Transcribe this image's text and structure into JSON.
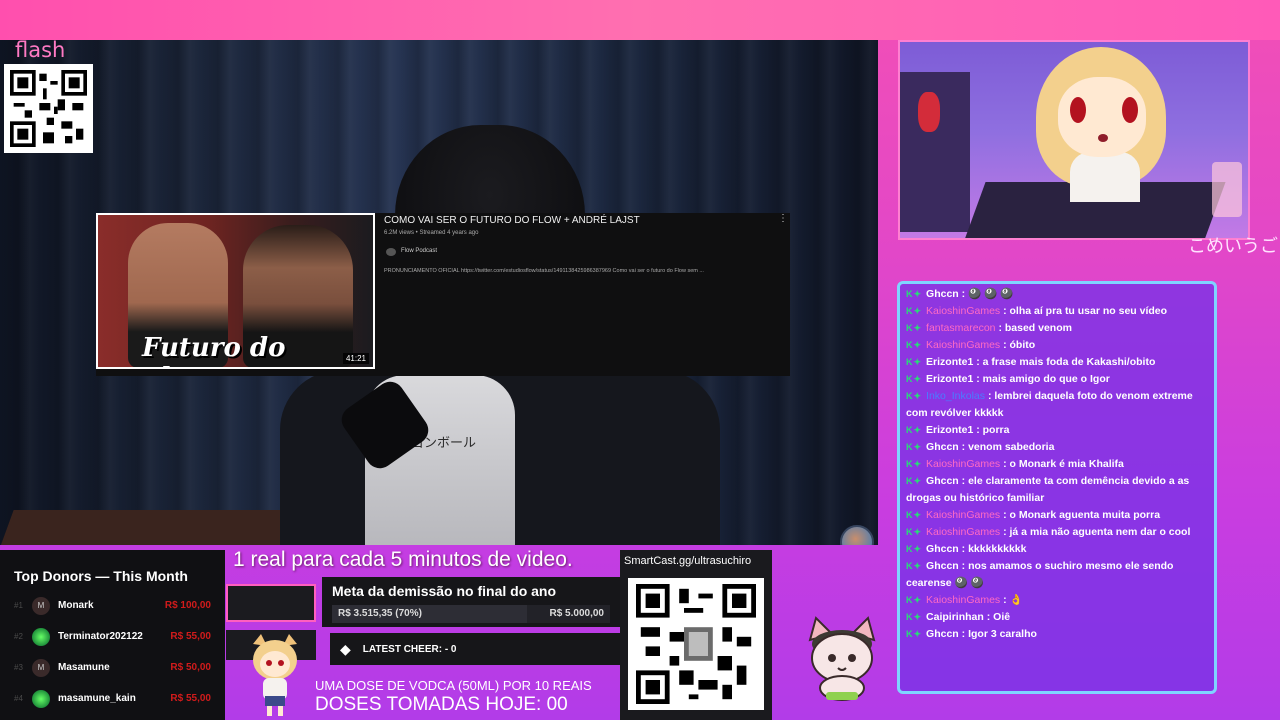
{
  "overlay": {
    "logo_text": "flash",
    "japanese_text": "こめいうご"
  },
  "youtube_card": {
    "thumb_title": "Futuro do Flow",
    "duration": "41:21",
    "title": "COMO VAI SER O FUTURO DO FLOW + ANDRÉ LAJST",
    "meta": "6.2M views • Streamed 4 years ago",
    "channel": "Flow Podcast",
    "description": "PRONUNCIAMENTO OFICIAL https://twitter.com/estudiosflow/status/1491138425986387969 Como vai ser o futuro do Flow sem ...",
    "menu_icon": "⋮"
  },
  "video": {
    "shirt_print": "ドラゴンボール"
  },
  "chat": {
    "badge_text": "K✦",
    "messages": [
      {
        "user": "Ghccn",
        "color": "white",
        "text": ": 🎱 🎱 🎱"
      },
      {
        "user": "KaioshinGames",
        "color": "pink",
        "text": ": olha aí pra tu usar no seu vídeo"
      },
      {
        "user": "fantasmarecon",
        "color": "pink",
        "text": ": based venom"
      },
      {
        "user": "KaioshinGames",
        "color": "pink",
        "text": ": óbito"
      },
      {
        "user": "Erizonte1",
        "color": "white",
        "text": ": a frase mais foda de Kakashi/obito"
      },
      {
        "user": "Erizonte1",
        "color": "white",
        "text": ": mais amigo do que o Igor"
      },
      {
        "user": "Inko_Inkolas",
        "color": "blue",
        "text": ": lembrei daquela foto do venom extreme com revólver kkkkk"
      },
      {
        "user": "Erizonte1",
        "color": "white",
        "text": ": porra"
      },
      {
        "user": "Ghccn",
        "color": "white",
        "text": ": venom sabedoria"
      },
      {
        "user": "KaioshinGames",
        "color": "pink",
        "text": ": o Monark é mia Khalifa"
      },
      {
        "user": "Ghccn",
        "color": "white",
        "text": ": ele claramente ta com demência devido a as drogas ou histórico familiar"
      },
      {
        "user": "KaioshinGames",
        "color": "pink",
        "text": ": o Monark aguenta muita porra"
      },
      {
        "user": "KaioshinGames",
        "color": "pink",
        "text": ": já a mia não aguenta nem dar o cool"
      },
      {
        "user": "Ghccn",
        "color": "white",
        "text": ": kkkkkkkkkk"
      },
      {
        "user": "Ghccn",
        "color": "white",
        "text": ": nos amamos o suchiro mesmo ele sendo cearense 🎱 🎱"
      },
      {
        "user": "KaioshinGames",
        "color": "pink",
        "text": ": 👌"
      },
      {
        "user": "Caipirinhan",
        "color": "white",
        "text": ": Oiê"
      },
      {
        "user": "Ghccn",
        "color": "white",
        "text": ": Igor 3 caralho"
      }
    ]
  },
  "donors": {
    "title": "Top Donors — This Month",
    "items": [
      {
        "rank": "#1",
        "avatar": "M",
        "name": "Monark",
        "amount": "R$ 100,00"
      },
      {
        "rank": "#2",
        "avatar": "",
        "name": "Terminator202122",
        "amount": "R$ 55,00"
      },
      {
        "rank": "#3",
        "avatar": "M",
        "name": "Masamune",
        "amount": "R$ 50,00"
      },
      {
        "rank": "#4",
        "avatar": "",
        "name": "masamune_kain",
        "amount": "R$ 55,00"
      }
    ]
  },
  "ticker": "1 real para cada 5 minutos de video.",
  "goal": {
    "title": "Meta da demissão no final do ano",
    "current": "R$ 3.515,35 (70%)",
    "target": "R$ 5.000,00",
    "progress": 0.7
  },
  "cheer": {
    "icon": "◆",
    "label": "LATEST CHEER: - 0"
  },
  "smartcast": {
    "label": "SmartCast.gg/ultrasuchiro"
  },
  "vodka": {
    "line1": "UMA DOSE DE VODCA (50ML) POR 10 REAIS",
    "line2": "DOSES TOMADAS HOJE: 00"
  },
  "colors": {
    "accent_pink": "#ff4fae",
    "chat_bg": "#7832e6",
    "chat_border": "#7fd4ff",
    "donation_red": "#d11b1b"
  }
}
